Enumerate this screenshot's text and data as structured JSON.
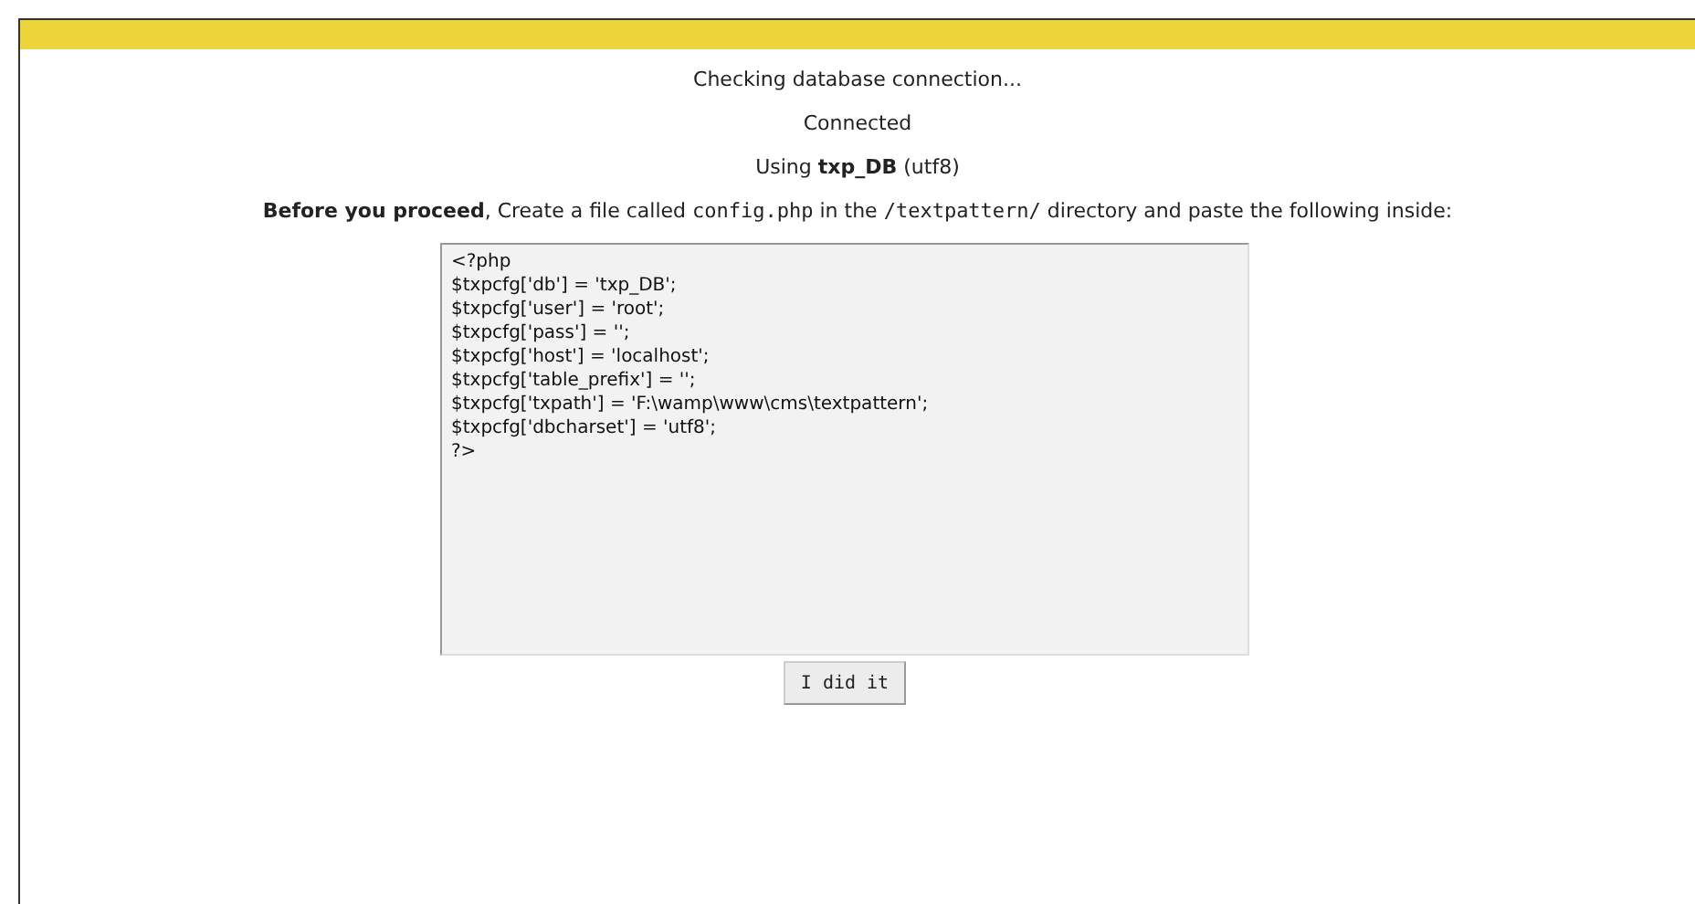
{
  "status_lines": [
    "Checking database connection...",
    "Connected",
    "Using **txp_DB** (utf8)"
  ],
  "instruction": [
    {
      "kind": "bold",
      "text": "Before you proceed"
    },
    {
      "kind": "text",
      "text": ", Create a file called "
    },
    {
      "kind": "code",
      "text": "config.php"
    },
    {
      "kind": "text",
      "text": " in the "
    },
    {
      "kind": "code",
      "text": "/textpattern/"
    },
    {
      "kind": "text",
      "text": " directory and paste the following inside:"
    }
  ],
  "config_code": [
    "<?php",
    "$txpcfg['db'] = 'txp_DB';",
    "$txpcfg['user'] = 'root';",
    "$txpcfg['pass'] = '';",
    "$txpcfg['host'] = 'localhost';",
    "$txpcfg['table_prefix'] = '';",
    "$txpcfg['txpath'] = 'F:\\wamp\\www\\cms\\textpattern';",
    "$txpcfg['dbcharset'] = 'utf8';",
    "?>"
  ],
  "button": "I did it"
}
